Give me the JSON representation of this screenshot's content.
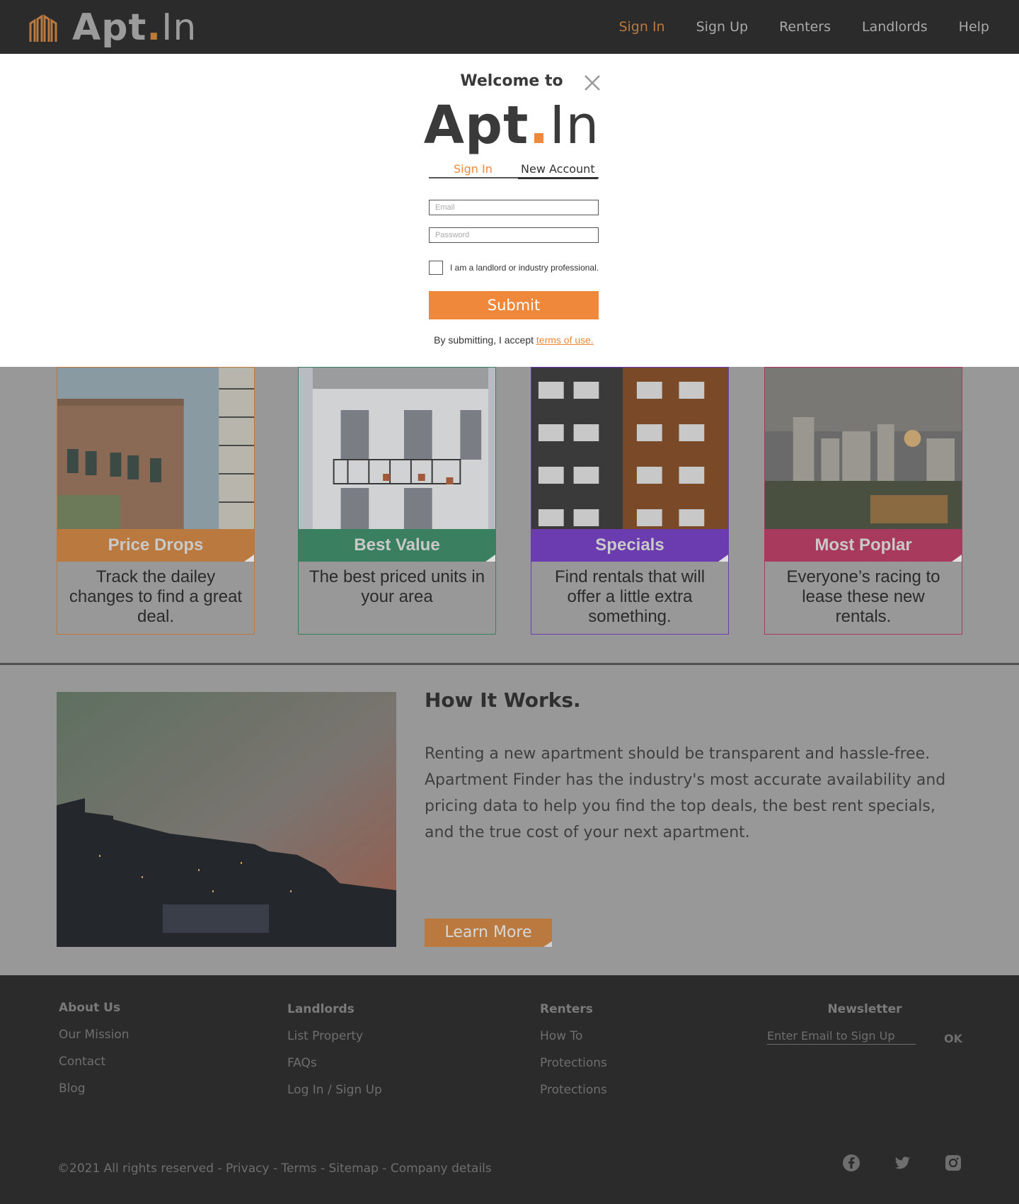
{
  "header": {
    "logo_text_main": "Apt",
    "logo_text_dot": ".",
    "logo_text_tail": "In",
    "nav": [
      "Sign In",
      "Sign Up",
      "Renters",
      "Landlords",
      "Help"
    ],
    "active_nav": "Sign In"
  },
  "modal": {
    "welcome": "Welcome to",
    "logo_main": "Apt",
    "logo_dot": ".",
    "logo_tail": "In",
    "tabs": {
      "signin": "Sign In",
      "new_account": "New Account"
    },
    "active_tab": "New Account",
    "email_placeholder": "Email",
    "password_placeholder": "Password",
    "checkbox_label": "I am a landlord or industry professional.",
    "checkbox_checked": false,
    "submit_label": "Submit",
    "terms_prefix": "By submitting, I accept ",
    "terms_link": "terms of use."
  },
  "cards": [
    {
      "title": "Price Drops",
      "desc": "Track the dailey changes to find a great deal.",
      "color": "#b9793f"
    },
    {
      "title": "Best Value",
      "desc": "The best priced units in your area",
      "color": "#3a8060"
    },
    {
      "title": "Specials",
      "desc": "Find rentals that will offer a little extra something.",
      "color": "#6b3bb0"
    },
    {
      "title": "Most Poplar",
      "desc": "Everyone’s racing to lease these new rentals.",
      "color": "#a83a5e"
    }
  ],
  "how_it_works": {
    "title": "How It Works.",
    "body": "Renting a new apartment should be transparent and hassle-free. Apartment Finder has the industry's most accurate availability and pricing data to help you find the top deals, the best rent specials, and the true cost of your next apartment.",
    "button": "Learn More"
  },
  "footer": {
    "columns": [
      {
        "head": "About Us",
        "links": [
          "Our Mission",
          "Contact",
          "Blog"
        ]
      },
      {
        "head": "Landlords",
        "links": [
          "List Property",
          "FAQs",
          "Log In / Sign Up"
        ]
      },
      {
        "head": "Renters",
        "links": [
          "How To",
          "Protections",
          "Protections"
        ]
      }
    ],
    "newsletter": {
      "head": "Newsletter",
      "placeholder": "Enter Email to Sign Up",
      "ok": "OK"
    },
    "copyright": "©2021 All rights reserved - Privacy - Terms - Sitemap - Company details",
    "social": [
      "facebook-icon",
      "twitter-icon",
      "instagram-icon"
    ]
  },
  "colors": {
    "header_bg": "#2b2b2b",
    "accent_orange": "#f0883c",
    "overlay_gray": "#989898"
  }
}
